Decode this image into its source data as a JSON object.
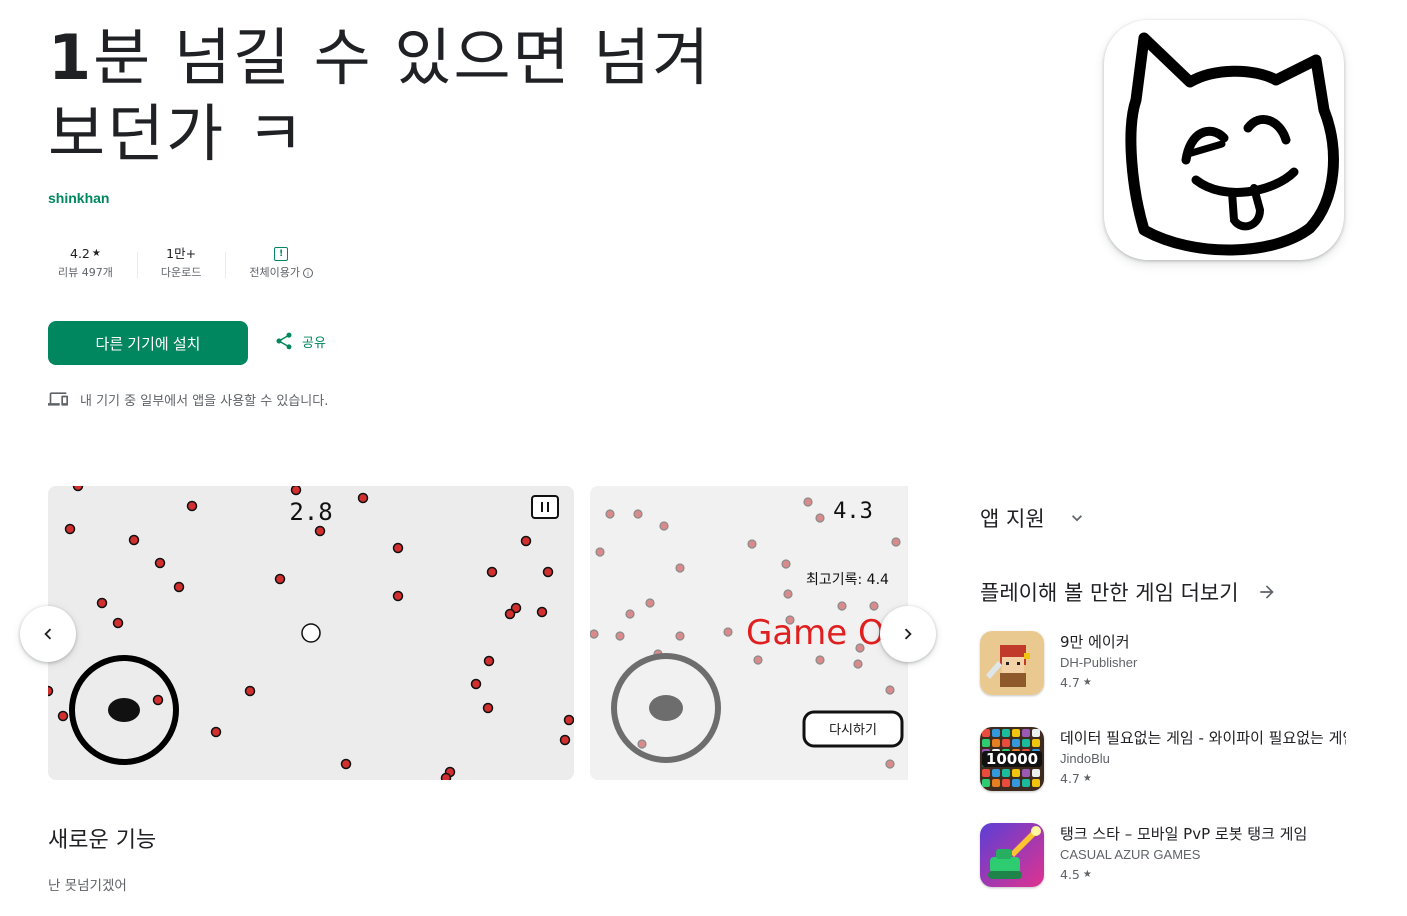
{
  "app": {
    "title_lead": "1",
    "title_rest": "분 넘길 수 있으면 넘겨",
    "title_line2": "보던가 ㅋ",
    "developer": "shinkhan"
  },
  "stats": {
    "rating_value": "4.2",
    "rating_label": "리뷰 497개",
    "downloads_value": "1만+",
    "downloads_label": "다운로드",
    "content_label": "전체이용가"
  },
  "actions": {
    "install_label": "다른 기기에 설치",
    "share_label": "공유",
    "device_note": "내 기기 중 일부에서 앱을 사용할 수 있습니다."
  },
  "screenshots": {
    "shot1_score": "2.8",
    "shot2_score": "4.3",
    "shot2_best": "최고기록: 4.4",
    "shot2_gameover": "Game O",
    "shot2_retry": "다시하기"
  },
  "whats_new": {
    "title": "새로운 기능",
    "body": "난 못넘기겠어"
  },
  "sidebar": {
    "app_support": "앱 지원",
    "more_games": "플레이해 볼 만한 게임 더보기",
    "recommendations": [
      {
        "name": "9만 에이커",
        "developer": "DH-Publisher",
        "rating": "4.7",
        "icon": "knight-game-icon"
      },
      {
        "name": "데이터 필요없는 게임 - 와이파이 필요없는 게임",
        "developer": "JindoBlu",
        "rating": "4.7",
        "icon": "10000-games-icon"
      },
      {
        "name": "탱크 스타 – 모바일 PvP 로봇 탱크 게임",
        "developer": "CASUAL AZUR GAMES",
        "rating": "4.5",
        "icon": "tank-game-icon"
      }
    ],
    "rec2_icon_text": "10000"
  },
  "colors": {
    "accent": "#01875f",
    "text": "#202124",
    "muted": "#5f6368",
    "dot_red": "#d32f2f"
  }
}
